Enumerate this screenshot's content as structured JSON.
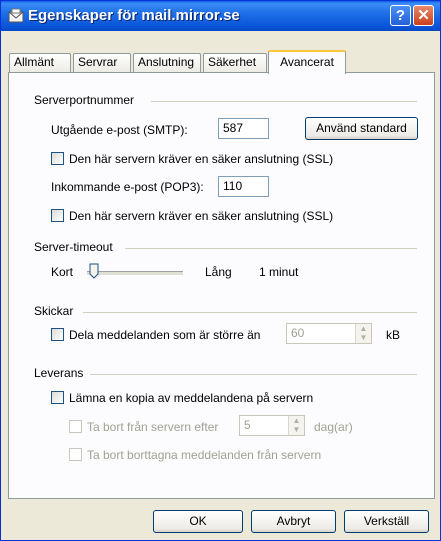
{
  "window": {
    "title": "Egenskaper för mail.mirror.se",
    "help_glyph": "?",
    "close_glyph": "✕"
  },
  "tabs": [
    "Allmänt",
    "Servrar",
    "Anslutning",
    "Säkerhet",
    "Avancerat"
  ],
  "active_tab": "Avancerat",
  "serverports": {
    "group_label": "Serverportnummer",
    "smtp_label": "Utgående e-post (SMTP):",
    "smtp_value": "587",
    "use_default_button": "Använd standard",
    "smtp_ssl_label": "Den här servern kräver en säker anslutning (SSL)",
    "smtp_ssl_checked": false,
    "pop3_label": "Inkommande e-post (POP3):",
    "pop3_value": "110",
    "pop3_ssl_label": "Den här servern kräver en säker anslutning (SSL)",
    "pop3_ssl_checked": false
  },
  "timeout": {
    "group_label": "Server-timeout",
    "short_label": "Kort",
    "long_label": "Lång",
    "value_text": "1 minut",
    "slider_fraction": 0.0
  },
  "sending": {
    "group_label": "Skickar",
    "split_label": "Dela meddelanden som är större än",
    "split_checked": false,
    "split_value": "60",
    "unit": "kB"
  },
  "delivery": {
    "group_label": "Leverans",
    "keep_copy_label": "Lämna en kopia av meddelandena på servern",
    "keep_copy_checked": false,
    "remove_after_label": "Ta bort från servern efter",
    "remove_after_value": "5",
    "remove_after_unit": "dag(ar)",
    "remove_deleted_label": "Ta bort borttagna meddelanden från servern"
  },
  "buttons": {
    "ok": "OK",
    "cancel": "Avbryt",
    "apply": "Verkställ"
  }
}
